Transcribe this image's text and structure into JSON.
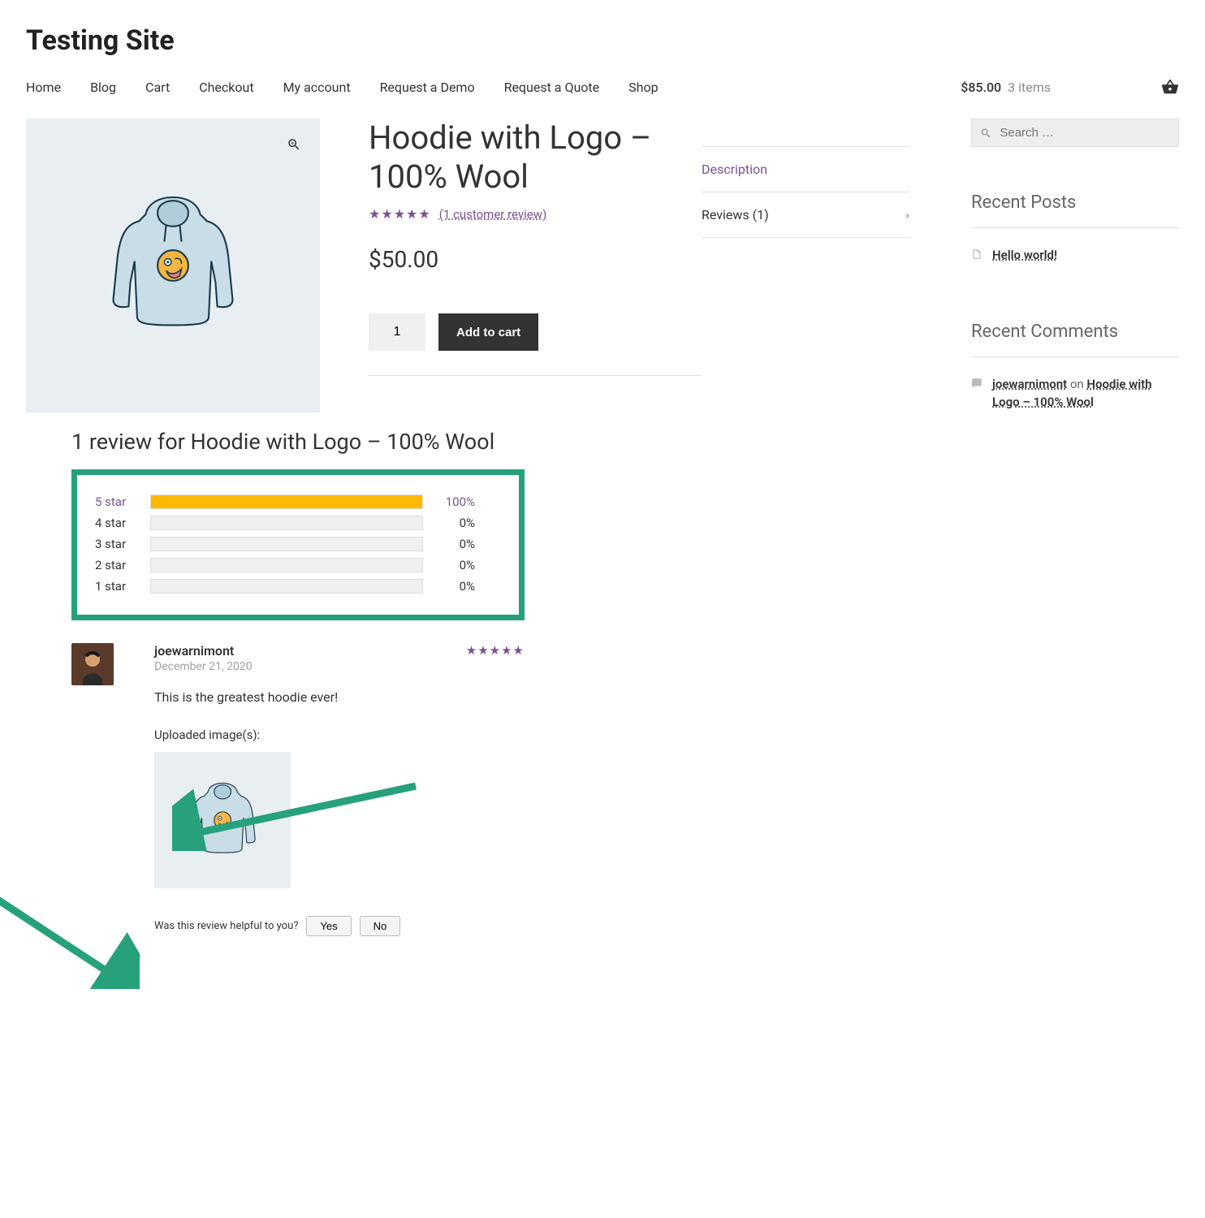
{
  "site_title": "Testing Site",
  "nav": [
    "Home",
    "Blog",
    "Cart",
    "Checkout",
    "My account",
    "Request a Demo",
    "Request a Quote",
    "Shop"
  ],
  "cart": {
    "amount": "$85.00",
    "items": "3 items"
  },
  "product": {
    "title": "Hoodie with Logo – 100% Wool",
    "rating_text": "(1 customer review)",
    "price": "$50.00",
    "qty": "1",
    "add_label": "Add to cart"
  },
  "tabs": {
    "description": "Description",
    "reviews": "Reviews (1)"
  },
  "reviews": {
    "heading": "1 review for Hoodie with Logo – 100% Wool",
    "histogram": [
      {
        "label": "5 star",
        "pct": "100%",
        "fill": 100,
        "active": true
      },
      {
        "label": "4 star",
        "pct": "0%",
        "fill": 0,
        "active": false
      },
      {
        "label": "3 star",
        "pct": "0%",
        "fill": 0,
        "active": false
      },
      {
        "label": "2 star",
        "pct": "0%",
        "fill": 0,
        "active": false
      },
      {
        "label": "1 star",
        "pct": "0%",
        "fill": 0,
        "active": false
      }
    ],
    "item": {
      "author": "joewarnimont",
      "date": "December 21, 2020",
      "text": "This is the greatest hoodie ever!",
      "uploaded_label": "Uploaded image(s):",
      "helpful_q": "Was this review helpful to you?",
      "yes": "Yes",
      "no": "No"
    }
  },
  "sidebar": {
    "search_placeholder": "Search …",
    "recent_posts_h": "Recent Posts",
    "recent_post": "Hello world!",
    "recent_comments_h": "Recent Comments",
    "comment_author": "joewarnimont",
    "comment_on": " on ",
    "comment_target": "Hoodie with Logo – 100% Wool"
  }
}
